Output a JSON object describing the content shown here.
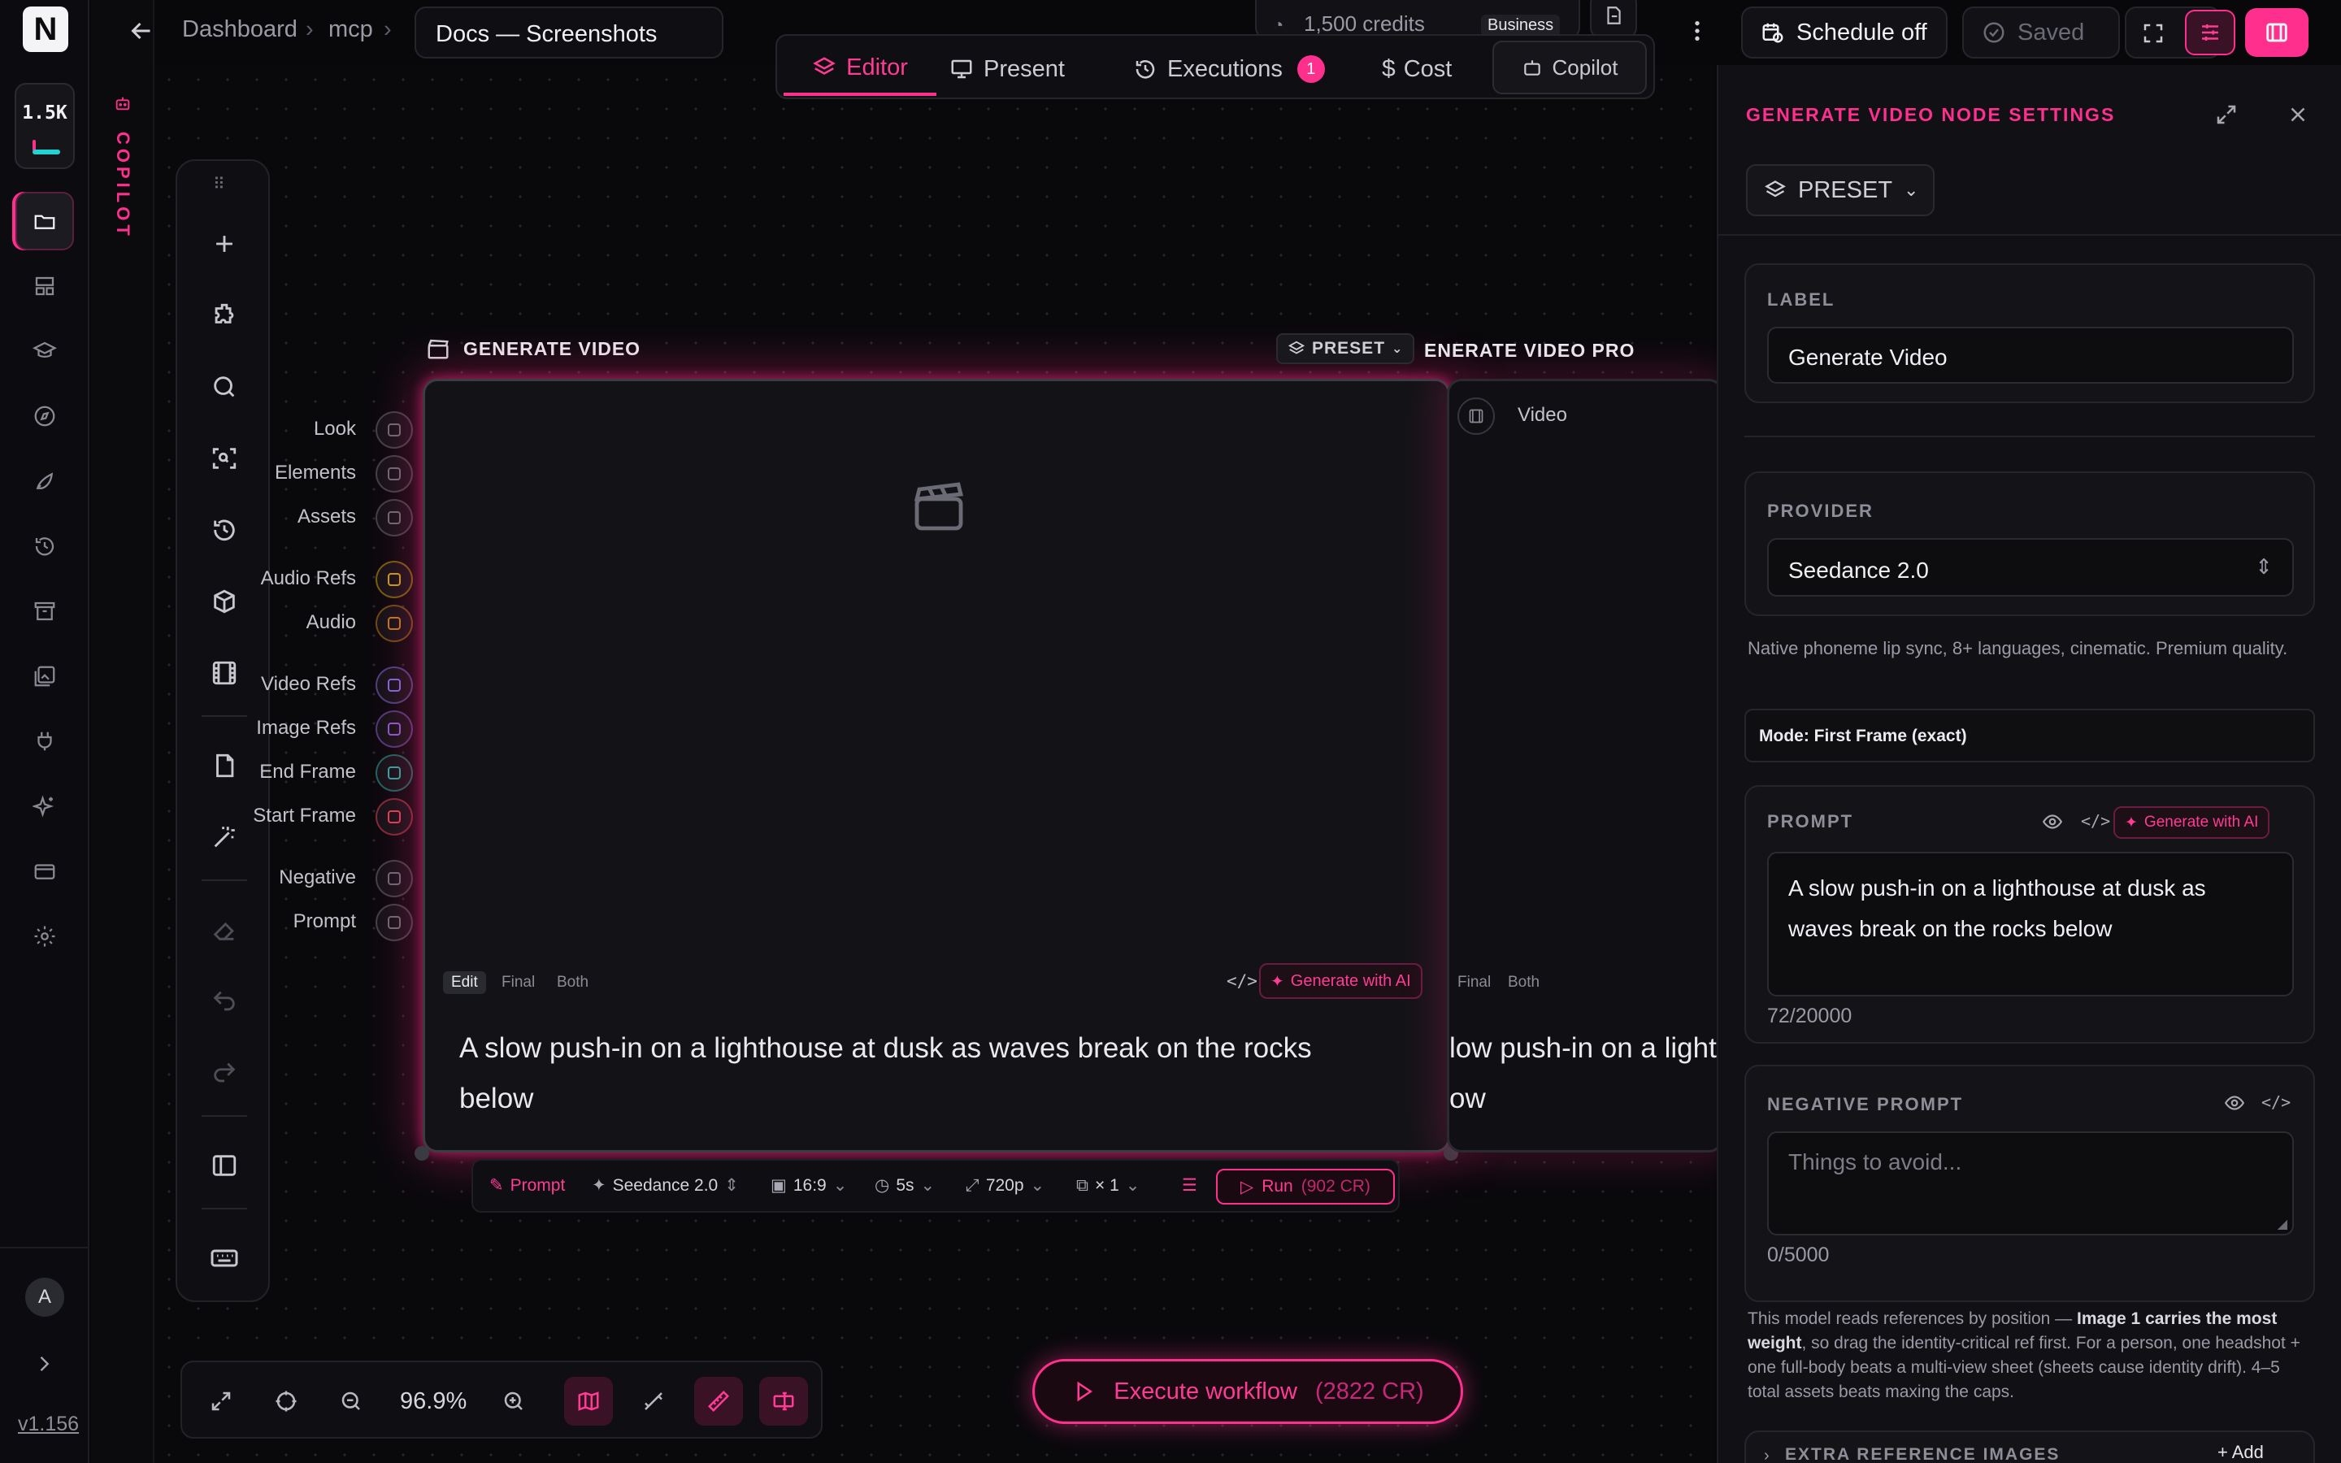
{
  "app": {
    "version": "v1.156",
    "logo_letter": "N",
    "user_initial": "A"
  },
  "credits_badge": "1.5K",
  "header": {
    "breadcrumb": [
      "Dashboard",
      "mcp"
    ],
    "doc_title": "Docs — Screenshots",
    "credits_text": "1,500 credits",
    "plan": "Business",
    "schedule_label": "Schedule off",
    "saved_label": "Saved"
  },
  "tabs": [
    {
      "label": "Editor",
      "active": true
    },
    {
      "label": "Present"
    },
    {
      "label": "Executions",
      "badge": "1"
    },
    {
      "label": "Cost"
    },
    {
      "label": "Copilot"
    }
  ],
  "copilot_strip_label": "COPILOT",
  "node": {
    "title": "GENERATE VIDEO",
    "ports": [
      "Look",
      "Elements",
      "Assets",
      "Audio Refs",
      "Audio",
      "Video Refs",
      "Image Refs",
      "End Frame",
      "Start Frame",
      "Negative",
      "Prompt"
    ],
    "segments": [
      "Edit",
      "Final",
      "Both"
    ],
    "generate_label": "Generate with AI",
    "prompt_text": "A slow push-in on a lighthouse at dusk as waves break on the rocks below"
  },
  "node2": {
    "preset_label": "PRESET",
    "title": "ENERATE VIDEO PRO",
    "output_port": "Video",
    "segments": [
      "Final",
      "Both"
    ],
    "prompt_line1": "low push-in on a light",
    "prompt_line2": "ow"
  },
  "node_toolbar": {
    "prompt": "Prompt",
    "model": "Seedance 2.0",
    "ratio": "16:9",
    "duration": "5s",
    "resolution": "720p",
    "count": "× 1",
    "run": "Run",
    "run_cost": "(902 CR)"
  },
  "zoom": {
    "level": "96.9%"
  },
  "execute": {
    "label": "Execute workflow",
    "cost": "(2822 CR)"
  },
  "panel": {
    "title": "GENERATE VIDEO NODE SETTINGS",
    "preset": "PRESET",
    "label_title": "LABEL",
    "label_value": "Generate Video",
    "provider_title": "PROVIDER",
    "provider_value": "Seedance 2.0",
    "provider_desc": "Native phoneme lip sync, 8+ languages, cinematic. Premium quality.",
    "mode": "Mode: First Frame (exact)",
    "prompt_title": "PROMPT",
    "generate_label": "Generate with AI",
    "prompt_value": "A slow push-in on a lighthouse at dusk as waves break on the rocks below",
    "prompt_count": "72/20000",
    "negative_title": "NEGATIVE PROMPT",
    "negative_placeholder": "Things to avoid...",
    "negative_count": "0/5000",
    "ref_note_pre": "This model reads references by position — ",
    "ref_note_bold": "Image 1 carries the most weight",
    "ref_note_post": ", so drag the identity-critical ref first. For a person, one headshot + one full-body beats a multi-view sheet (sheets cause identity drift). 4–5 total assets beats maxing the caps.",
    "extra_refs": "EXTRA REFERENCE IMAGES",
    "add": "Add"
  },
  "colors": {
    "accent": "#ff2f8e",
    "bg": "#08080b",
    "panel": "#111115"
  }
}
